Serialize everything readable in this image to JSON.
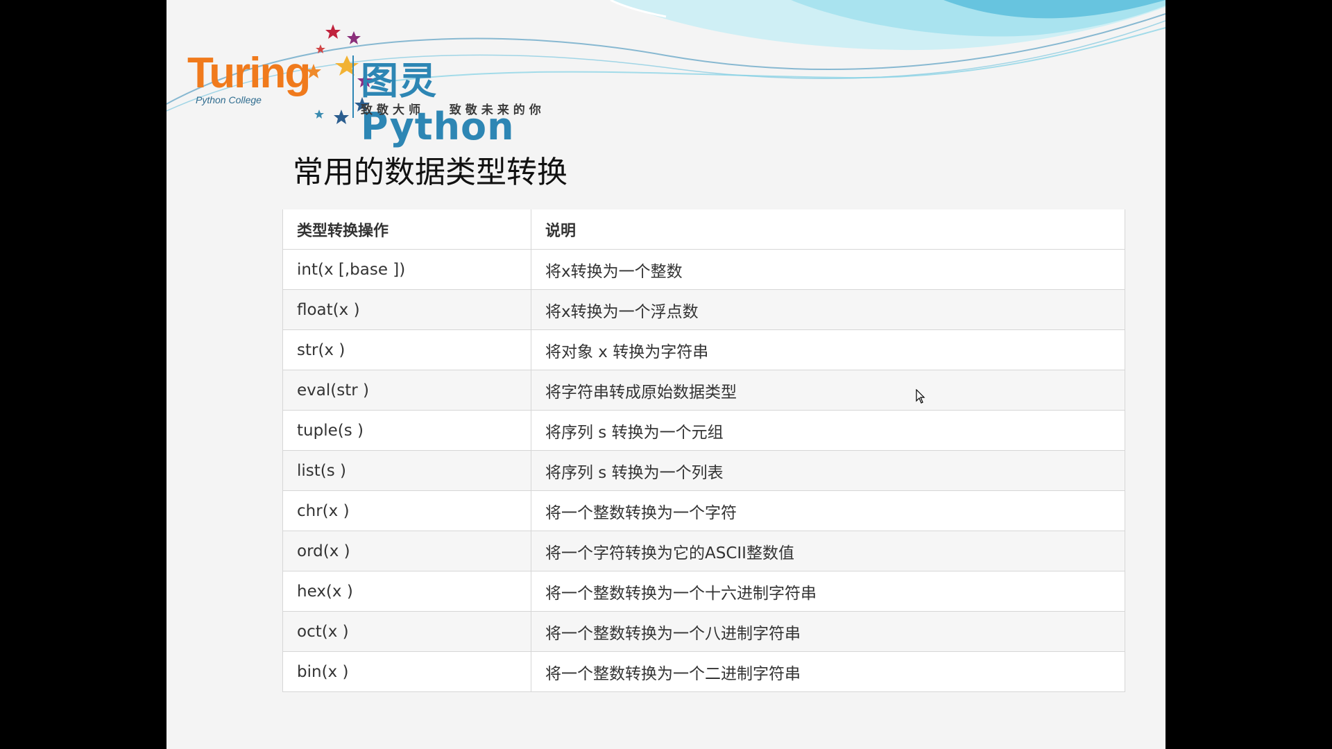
{
  "logo": {
    "wordmark": "Turing",
    "college": "Python College",
    "brand": "图灵Python",
    "slogan": "致敬大师   致敬未来的你"
  },
  "title": "常用的数据类型转换",
  "table": {
    "headers": [
      "类型转换操作",
      "说明"
    ],
    "rows": [
      {
        "op": "int(x [,base ])",
        "desc": "将x转换为一个整数"
      },
      {
        "op": "float(x )",
        "desc": "将x转换为一个浮点数"
      },
      {
        "op": "str(x )",
        "desc": "将对象 x 转换为字符串"
      },
      {
        "op": "eval(str )",
        "desc": "将字符串转成原始数据类型"
      },
      {
        "op": "tuple(s )",
        "desc": "将序列 s 转换为一个元组"
      },
      {
        "op": "list(s )",
        "desc": "将序列 s 转换为一个列表"
      },
      {
        "op": "chr(x )",
        "desc": "将一个整数转换为一个字符"
      },
      {
        "op": "ord(x )",
        "desc": "将一个字符转换为它的ASCII整数值"
      },
      {
        "op": "hex(x )",
        "desc": "将一个整数转换为一个十六进制字符串"
      },
      {
        "op": "oct(x )",
        "desc": "将一个整数转换为一个八进制字符串"
      },
      {
        "op": "bin(x )",
        "desc": "将一个整数转换为一个二进制字符串"
      }
    ]
  },
  "colors": {
    "slide_bg": "#f4f4f4",
    "logo_orange": "#f07a1c",
    "logo_blue": "#2d86b4",
    "wave_light": "#a9e3ef",
    "wave_mid": "#4cb6d8"
  }
}
